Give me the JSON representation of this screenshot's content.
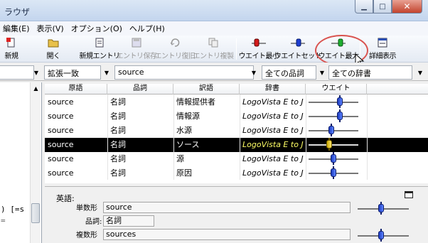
{
  "window": {
    "title": "ラウザ",
    "minimize_glyph": "▁",
    "restore_glyph": "□",
    "close_glyph": "✕"
  },
  "menu": [
    "編集(E)",
    "表示(V)",
    "オプション(O)",
    "ヘルプ(H)"
  ],
  "toolbar": [
    {
      "label": "新規",
      "icon": "new-icon",
      "enabled": true
    },
    {
      "label": "開く",
      "icon": "open-folder-icon",
      "enabled": true
    },
    {
      "label": "新規エントリ",
      "icon": "new-entry-icon",
      "enabled": true
    },
    {
      "label": "エントリ保存",
      "icon": "save-entry-icon",
      "enabled": false
    },
    {
      "label": "エントリ復旧",
      "icon": "restore-entry-icon",
      "enabled": false
    },
    {
      "label": "エントリ複製",
      "icon": "duplicate-entry-icon",
      "enabled": false
    },
    {
      "label": "ウエイト最小",
      "icon": "weight-min-icon",
      "enabled": true
    },
    {
      "label": "ウエイトセット",
      "icon": "weight-set-icon",
      "enabled": true
    },
    {
      "label": "ウエイト最大",
      "icon": "weight-max-icon",
      "enabled": true
    },
    {
      "label": "詳細表示",
      "icon": "detail-view-icon",
      "enabled": true
    }
  ],
  "filters": {
    "match_mode": "拡張一致",
    "search_text": "source",
    "part_of_speech": "全ての品詞",
    "dictionary": "全ての辞書"
  },
  "grid": {
    "columns": [
      "原語",
      "品詞",
      "訳語",
      "辞書",
      "ウエイト"
    ],
    "rows": [
      {
        "word": "source",
        "pos": "名詞",
        "translation": "情報提供者",
        "dict": "LogoVista E to J",
        "weight": 0.65,
        "selected": false
      },
      {
        "word": "source",
        "pos": "名詞",
        "translation": "情報源",
        "dict": "LogoVista E to J",
        "weight": 0.65,
        "selected": false
      },
      {
        "word": "source",
        "pos": "名詞",
        "translation": "水源",
        "dict": "LogoVista E to J",
        "weight": 0.45,
        "selected": false
      },
      {
        "word": "source",
        "pos": "名詞",
        "translation": "ソース",
        "dict": "LogoVista E to J",
        "weight": 0.4,
        "selected": true
      },
      {
        "word": "source",
        "pos": "名詞",
        "translation": "源",
        "dict": "LogoVista E to J",
        "weight": 0.5,
        "selected": false
      },
      {
        "word": "source",
        "pos": "名詞",
        "translation": "原因",
        "dict": "LogoVista E to J",
        "weight": 0.5,
        "selected": false
      }
    ]
  },
  "detail": {
    "section_label": "英語:",
    "singular_label": "単数形",
    "singular_value": "source",
    "pos_label": "品詞:",
    "pos_value": "名詞",
    "plural_label": "複数形",
    "plural_value": "sources",
    "singular_weight": 0.45,
    "plural_weight": 0.45
  },
  "left_panel": {
    "fragment1": ") [=s",
    "fragment2": "="
  }
}
